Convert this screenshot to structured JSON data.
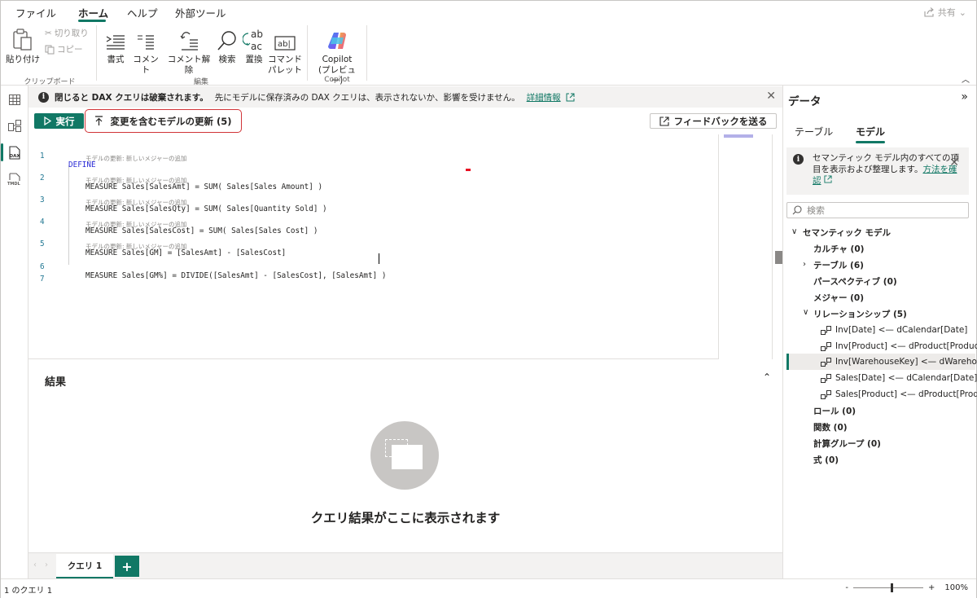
{
  "menu": {
    "items": [
      "ファイル",
      "ホーム",
      "ヘルプ",
      "外部ツール"
    ],
    "active": "ホーム",
    "share": "共有"
  },
  "ribbon": {
    "paste": "貼り付け",
    "cut": "切り取り",
    "copy": "コピー",
    "clipboard_group": "クリップボード",
    "format": "書式",
    "comment": "コメント",
    "uncomment": "コメント解除",
    "find": "検索",
    "replace": "置換",
    "command_palette_1": "コマンド",
    "command_palette_2": "パレット",
    "edit_group": "編集",
    "copilot_1": "Copilot",
    "copilot_2": "(プレビュー)",
    "copilot_group": "Copilot"
  },
  "rail": {
    "dax_label": "DAX",
    "tmdl_label": "TMDL"
  },
  "infobar": {
    "bold": "閉じると DAX クエリは破棄されます。",
    "text": "先にモデルに保存済みの DAX クエリは、表示されないか、影響を受けません。",
    "link": "詳細情報"
  },
  "toolbar": {
    "run": "実行",
    "update_model": "変更を含むモデルの更新 (5)",
    "feedback": "フィードバックを送る"
  },
  "editor": {
    "hint": "モデルの更新: 新しいメジャーの追加",
    "lines": [
      {
        "n": "1",
        "text": "DEFINE"
      },
      {
        "n": "2",
        "text": "MEASURE Sales[SalesAmt] = SUM( Sales[Sales Amount] )"
      },
      {
        "n": "3",
        "text": "MEASURE Sales[SalesQty] = SUM( Sales[Quantity Sold] )"
      },
      {
        "n": "4",
        "text": "MEASURE Sales[SalesCost] = SUM( Sales[Sales Cost] )"
      },
      {
        "n": "5",
        "text": "MEASURE Sales[GM] = [SalesAmt] - [SalesCost]"
      },
      {
        "n": "6",
        "text": "MEASURE Sales[GM%] = DIVIDE([SalesAmt] - [SalesCost], [SalesAmt] )"
      },
      {
        "n": "7",
        "text": ""
      }
    ]
  },
  "results": {
    "title": "結果",
    "empty": "クエリ結果がここに表示されます"
  },
  "tabs": {
    "query1": "クエリ 1",
    "add": "+"
  },
  "status": {
    "left": "1 のクエリ 1",
    "zoom_minus": "-",
    "zoom_plus": "+",
    "zoom": "100%"
  },
  "datapane": {
    "title": "データ",
    "tab_table": "テーブル",
    "tab_model": "モデル",
    "note_text": "セマンティック モデル内のすべての項目を表示および整理します。",
    "note_link": "方法を確認",
    "search_placeholder": "検索",
    "tree": {
      "root": "セマンティック モデル",
      "cultures": "カルチャ (0)",
      "tables": "テーブル (6)",
      "perspectives": "パースペクティブ (0)",
      "measures": "メジャー (0)",
      "relationships": "リレーションシップ (5)",
      "rels": [
        "Inv[Date] <— dCalendar[Date]",
        "Inv[Product] <— dProduct[Product]",
        "Inv[WarehouseKey] <— dWarehous...",
        "Sales[Date] <— dCalendar[Date]",
        "Sales[Product] <— dProduct[Produ..."
      ],
      "roles": "ロール (0)",
      "functions": "関数 (0)",
      "calc_groups": "計算グループ (0)",
      "expressions": "式 (0)"
    }
  },
  "colors": {
    "accent": "#117865",
    "highlight_border": "#d13438"
  }
}
